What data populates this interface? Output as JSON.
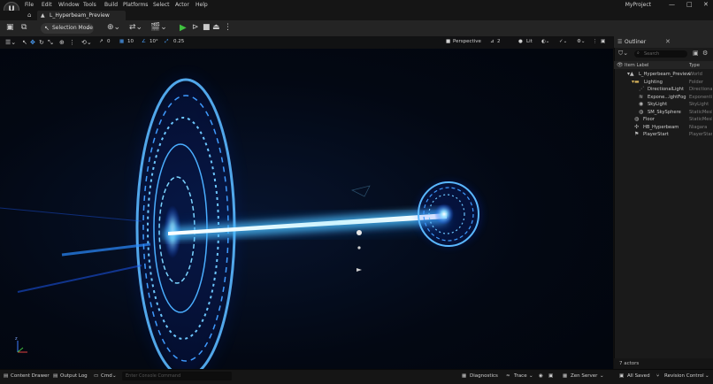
{
  "menu": [
    "File",
    "Edit",
    "Window",
    "Tools",
    "Build",
    "Platforms",
    "Select",
    "Actor",
    "Help"
  ],
  "project_name": "MyProject",
  "window_controls": {
    "minimize": "—",
    "maximize": "□",
    "close": "✕"
  },
  "tab": {
    "title": "L_Hyperbeam_Preview"
  },
  "toolbar": {
    "selection_mode": "Selection Mode"
  },
  "viewport_toolbar": {
    "rotation_snap": "0",
    "grid_snap": "10",
    "angle_snap": "10°",
    "scale_snap": "0.25",
    "perspective": "Perspective",
    "camera_speed": "2",
    "lit": "Lit"
  },
  "outliner": {
    "title": "Outliner",
    "search_placeholder": "Search",
    "columns": {
      "label": "Item Label",
      "type": "Type"
    },
    "items": [
      {
        "name": "L_Hyperbeam_Preview",
        "type": "World",
        "icon": "world-icon"
      },
      {
        "name": "Lighting",
        "type": "Folder",
        "icon": "folder-icon"
      },
      {
        "name": "DirectionalLight",
        "type": "Directional",
        "icon": "directional-light-icon"
      },
      {
        "name": "Expone...ightFog",
        "type": "ExponentialH",
        "icon": "fog-icon"
      },
      {
        "name": "SkyLight",
        "type": "SkyLight",
        "icon": "skylight-icon"
      },
      {
        "name": "SM_SkySphere",
        "type": "StaticMesh",
        "icon": "sphere-icon"
      },
      {
        "name": "Floor",
        "type": "StaticMesh",
        "icon": "mesh-icon"
      },
      {
        "name": "HB_Hyperbeam",
        "type": "Niagara",
        "icon": "niagara-icon"
      },
      {
        "name": "PlayerStart",
        "type": "PlayerStart",
        "icon": "player-start-icon"
      }
    ],
    "footer": "7 actors"
  },
  "statusbar": {
    "content_drawer": "Content Drawer",
    "output_log": "Output Log",
    "cmd": "Cmd",
    "cmd_placeholder": "Enter Console Command",
    "diagnostics": "Diagnostics",
    "trace": "Trace",
    "zen_server": "Zen Server",
    "all_saved": "All Saved",
    "revision_control": "Revision Control"
  },
  "colors": {
    "beam": "#4fc3ff",
    "glow": "#1e88ff",
    "play": "#3fc23f"
  }
}
